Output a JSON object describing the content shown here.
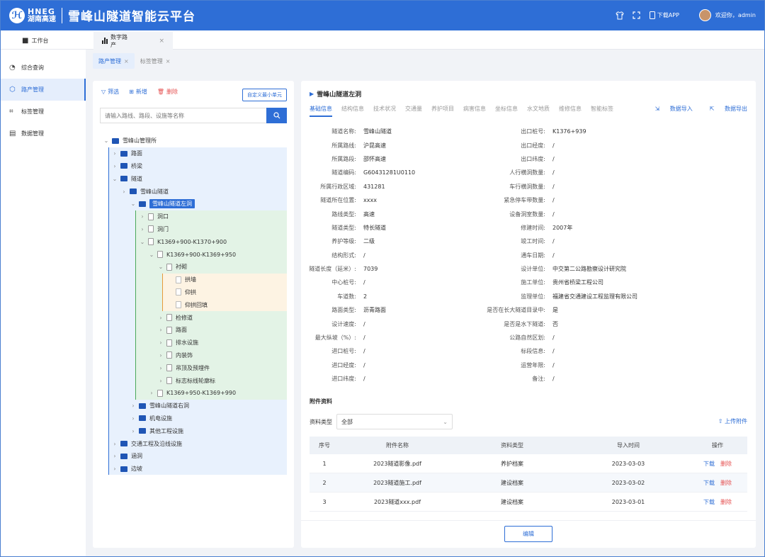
{
  "header": {
    "logo_en": "HNEG",
    "logo_cn": "湖南高速",
    "app_title": "雪峰山隧道智能云平台",
    "download_label": "下载APP",
    "welcome": "欢迎你，admin"
  },
  "tabs": [
    {
      "label": "工作台",
      "icon": "grid-icon"
    },
    {
      "label": "数字路产",
      "icon": "bar-chart-icon",
      "close": "×"
    }
  ],
  "sidebar": {
    "items": [
      {
        "label": "综合查询",
        "icon": "pie-chart-icon"
      },
      {
        "label": "路产管理",
        "icon": "hexagon-icon"
      },
      {
        "label": "标签管理",
        "icon": "tag-scan-icon"
      },
      {
        "label": "数据管理",
        "icon": "database-icon"
      }
    ]
  },
  "subtabs": [
    {
      "label": "路产管理",
      "close": "×"
    },
    {
      "label": "标签管理",
      "close": "×"
    }
  ],
  "left_panel": {
    "filter_label": "筛选",
    "add_label": "新增",
    "delete_label": "删除",
    "custom_button": "自定义最小单元",
    "search_placeholder": "请输入路线、路段、设施等名称",
    "tree": [
      {
        "label": "雪峰山管理所"
      },
      {
        "label": "路面"
      },
      {
        "label": "桥梁"
      },
      {
        "label": "隧道"
      },
      {
        "label": "雪峰山隧道"
      },
      {
        "label": "雪峰山隧道左洞"
      },
      {
        "label": "洞口"
      },
      {
        "label": "洞门"
      },
      {
        "label": "K1369+900-K1370+900"
      },
      {
        "label": "K1369+900-K1369+950"
      },
      {
        "label": "衬砌"
      },
      {
        "label": "拱墙"
      },
      {
        "label": "仰拱"
      },
      {
        "label": "仰拱回填"
      },
      {
        "label": "检修道"
      },
      {
        "label": "路面"
      },
      {
        "label": "排水设施"
      },
      {
        "label": "内装饰"
      },
      {
        "label": "吊顶及预埋件"
      },
      {
        "label": "标志标线轮廓标"
      },
      {
        "label": "K1369+950-K1369+990"
      },
      {
        "label": "雪峰山隧道右洞"
      },
      {
        "label": "机电设施"
      },
      {
        "label": "其他工程设施"
      },
      {
        "label": "交通工程及沿线设施"
      },
      {
        "label": "涵洞"
      },
      {
        "label": "边坡"
      }
    ]
  },
  "right_panel": {
    "title": "雪峰山隧道左洞",
    "tabs": [
      "基础信息",
      "结构信息",
      "技术状况",
      "交通量",
      "养护项目",
      "病害信息",
      "坐标信息",
      "水文地质",
      "维修信息",
      "智能标签"
    ],
    "import_label": "数据导入",
    "export_label": "数据导出",
    "left_fields": [
      {
        "label": "隧道名称:",
        "value": "雪峰山隧道"
      },
      {
        "label": "所属路线:",
        "value": "沪昆高速"
      },
      {
        "label": "所属路段:",
        "value": "邵怀高速"
      },
      {
        "label": "隧道编码:",
        "value": "G60431281U0110"
      },
      {
        "label": "所属行政区域:",
        "value": "431281"
      },
      {
        "label": "隧道所在位置:",
        "value": "xxxx"
      },
      {
        "label": "路线类型:",
        "value": "高速"
      },
      {
        "label": "隧道类型:",
        "value": "特长隧道"
      },
      {
        "label": "养护等级:",
        "value": "二级"
      },
      {
        "label": "结构形式:",
        "value": "/"
      },
      {
        "label": "隧道长度（延米）:",
        "value": "7039"
      },
      {
        "label": "中心桩号:",
        "value": "/"
      },
      {
        "label": "车道数:",
        "value": "2"
      },
      {
        "label": "路面类型:",
        "value": "沥青路面"
      },
      {
        "label": "设计速度:",
        "value": "/"
      },
      {
        "label": "最大纵坡（%）:",
        "value": "/"
      },
      {
        "label": "进口桩号:",
        "value": "/"
      },
      {
        "label": "进口经度:",
        "value": "/"
      },
      {
        "label": "进口纬度:",
        "value": "/"
      }
    ],
    "right_fields": [
      {
        "label": "出口桩号:",
        "value": "K1376+939"
      },
      {
        "label": "出口经度:",
        "value": "/"
      },
      {
        "label": "出口纬度:",
        "value": "/"
      },
      {
        "label": "人行横洞数量:",
        "value": "/"
      },
      {
        "label": "车行横洞数量:",
        "value": "/"
      },
      {
        "label": "紧急停车带数量:",
        "value": "/"
      },
      {
        "label": "设备洞室数量:",
        "value": "/"
      },
      {
        "label": "修建时间:",
        "value": "2007年"
      },
      {
        "label": "竣工时间:",
        "value": "/"
      },
      {
        "label": "通车日期:",
        "value": "/"
      },
      {
        "label": "设计单位:",
        "value": "中交第二公路勘察设计研究院"
      },
      {
        "label": "施工单位:",
        "value": "贵州省桥梁工程公司"
      },
      {
        "label": "监理单位:",
        "value": "福建省交通建设工程监理有限公司"
      },
      {
        "label": "是否在长大隧道目录中:",
        "value": "是"
      },
      {
        "label": "是否是水下隧道:",
        "value": "否"
      },
      {
        "label": "公路自然区划:",
        "value": "/"
      },
      {
        "label": "标段信息:",
        "value": "/"
      },
      {
        "label": "运营年限:",
        "value": "/"
      },
      {
        "label": "备注:",
        "value": "/"
      }
    ],
    "attachments": {
      "title": "附件资料",
      "filter_label": "资料类型",
      "filter_value": "全部",
      "upload_label": "上传附件",
      "columns": [
        "序号",
        "附件名称",
        "资料类型",
        "导入时间",
        "操作"
      ],
      "rows": [
        {
          "no": "1",
          "name": "2023隧道影像.pdf",
          "type": "养护档案",
          "time": "2023-03-03"
        },
        {
          "no": "2",
          "name": "2023隧道施工.pdf",
          "type": "建设档案",
          "time": "2023-03-02"
        },
        {
          "no": "3",
          "name": "2023隧道xxx.pdf",
          "type": "建设档案",
          "time": "2023-03-01"
        }
      ],
      "download_label": "下载",
      "delete_label": "删除"
    },
    "edit_label": "编辑"
  },
  "colors": {
    "primary": "#2e6ed6",
    "danger": "#e55050",
    "tree_blue": "#e8f1fd",
    "tree_green": "#e3f3e6",
    "tree_peach": "#fdf3e3"
  }
}
